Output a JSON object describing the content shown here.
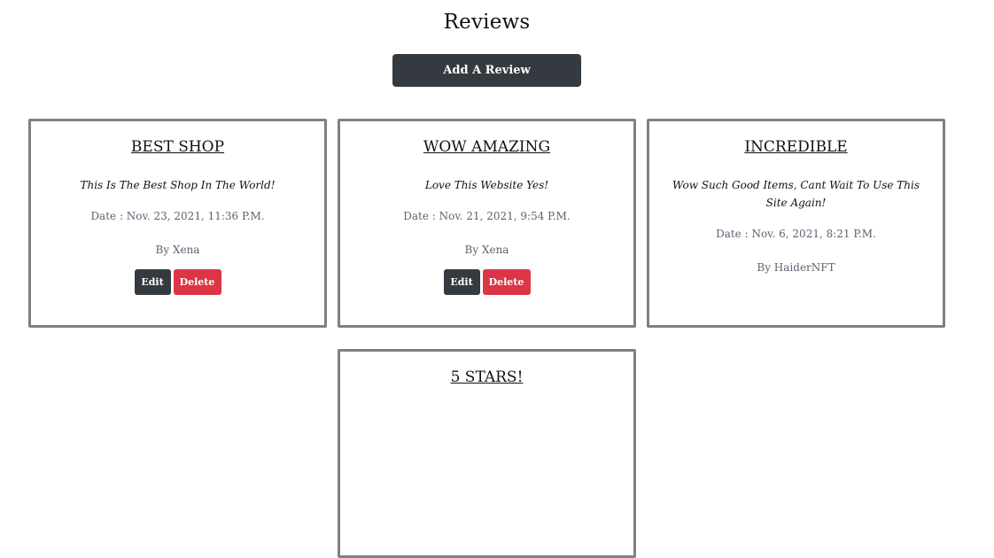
{
  "page": {
    "title": "Reviews",
    "add_button_label": "Add A Review"
  },
  "reviews": [
    {
      "title": "BEST SHOP",
      "body": "This Is The Best Shop In The World!",
      "date": "Date : Nov. 23, 2021, 11:36 P.M.",
      "author": "By Xena",
      "edit_label": "Edit",
      "delete_label": "Delete"
    },
    {
      "title": "WOW AMAZING",
      "body": "Love This Website Yes!",
      "date": "Date : Nov. 21, 2021, 9:54 P.M.",
      "author": "By Xena",
      "edit_label": "Edit",
      "delete_label": "Delete"
    },
    {
      "title": "INCREDIBLE",
      "body": "Wow Such Good Items, Cant Wait To Use This Site Again!",
      "date": "Date : Nov. 6, 2021, 8:21 P.M.",
      "author": "By HaiderNFT"
    },
    {
      "title": "5 STARS!"
    }
  ],
  "colors": {
    "dark_button": "#343a40",
    "danger_button": "#dc3545",
    "card_border": "#808080",
    "muted_text": "#5a6470"
  }
}
